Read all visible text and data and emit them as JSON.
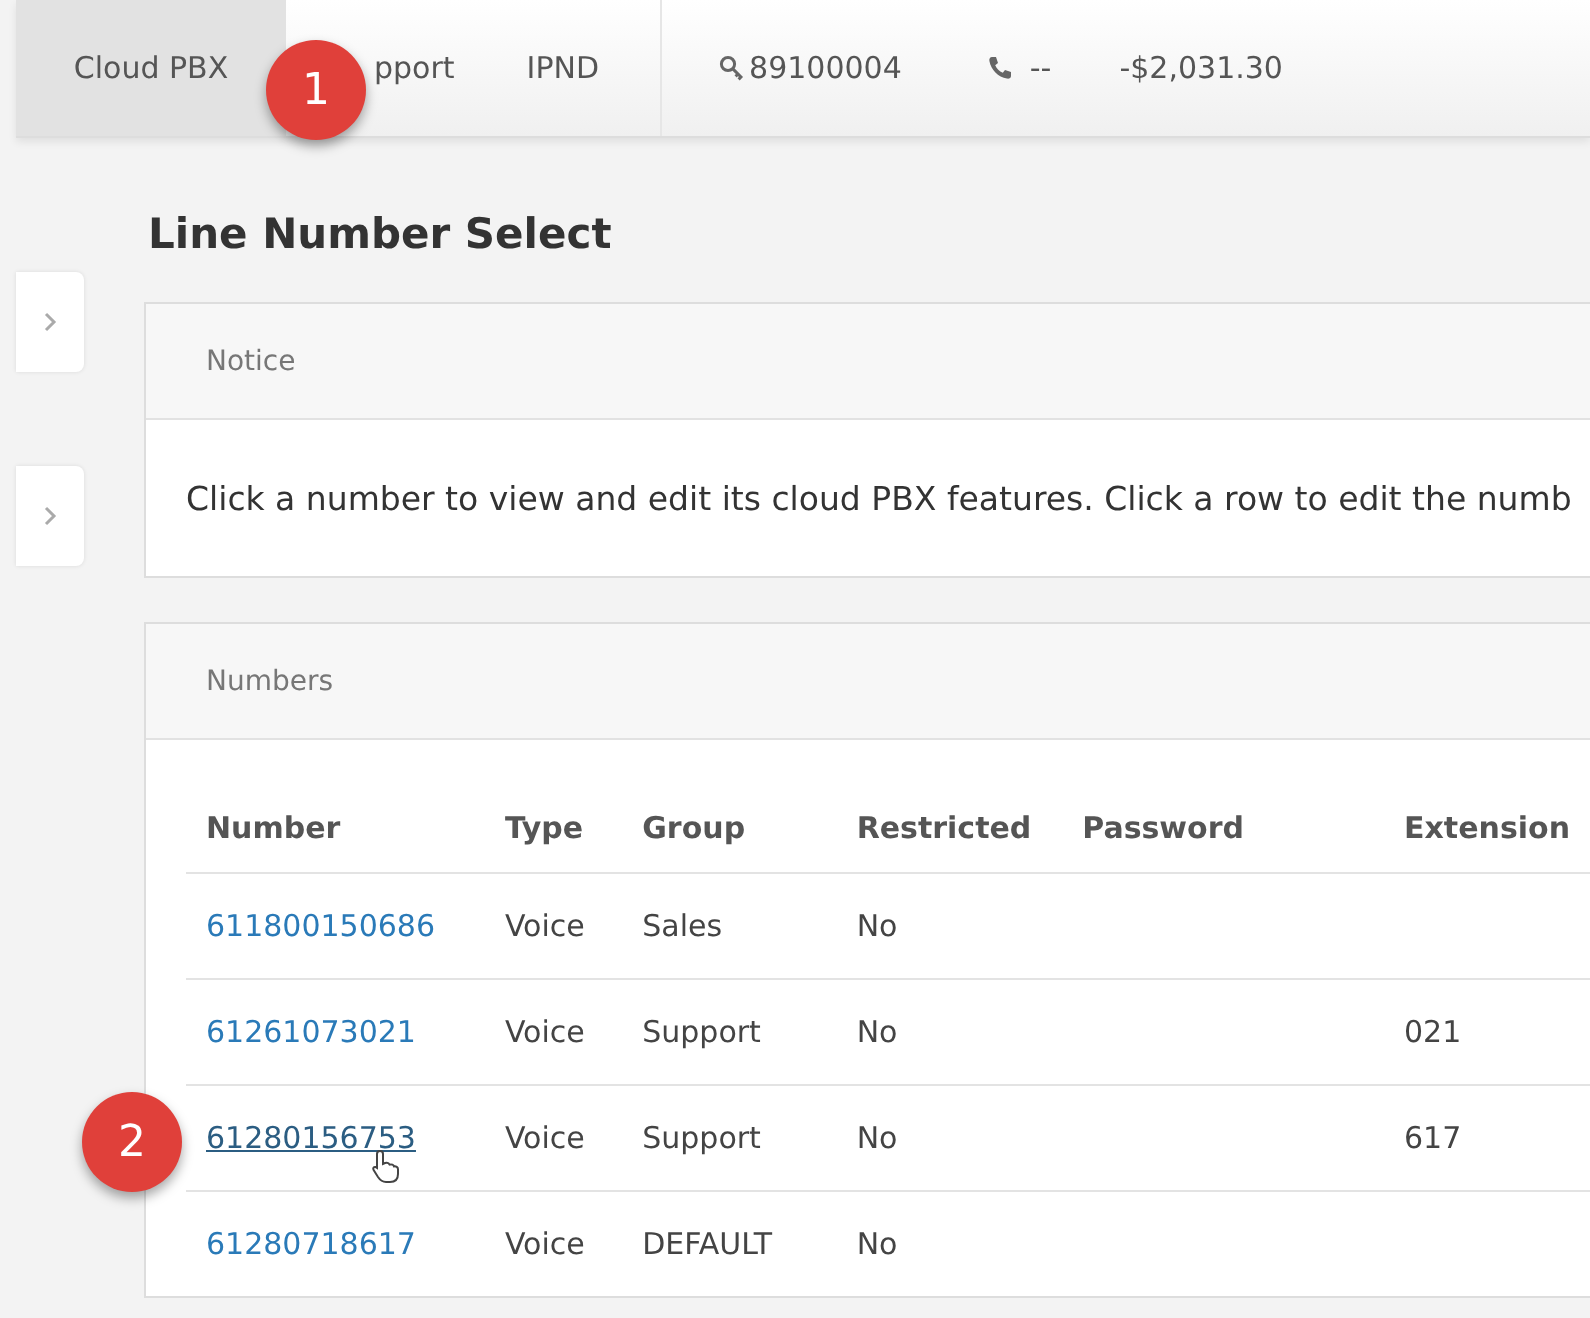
{
  "nav": {
    "items": [
      {
        "label": "Cloud PBX",
        "selected": true
      },
      {
        "label": "pport",
        "selected": false
      },
      {
        "label": "IPND",
        "selected": false
      }
    ],
    "account": "89100004",
    "phone": "--",
    "balance": "-$2,031.30"
  },
  "annotations": [
    "1",
    "2"
  ],
  "page_title": "Line Number Select",
  "notice": {
    "title": "Notice",
    "text": "Click a number to view and edit its cloud PBX features. Click a row to edit the numb"
  },
  "numbers": {
    "title": "Numbers",
    "columns": [
      "Number",
      "Type",
      "Group",
      "Restricted",
      "Password",
      "Extension"
    ],
    "rows": [
      {
        "number": "611800150686",
        "type": "Voice",
        "group": "Sales",
        "restricted": "No",
        "extension": "",
        "hovered": false
      },
      {
        "number": "61261073021",
        "type": "Voice",
        "group": "Support",
        "restricted": "No",
        "extension": "021",
        "hovered": false
      },
      {
        "number": "61280156753",
        "type": "Voice",
        "group": "Support",
        "restricted": "No",
        "extension": "617",
        "hovered": true
      },
      {
        "number": "61280718617",
        "type": "Voice",
        "group": "DEFAULT",
        "restricted": "No",
        "extension": "",
        "hovered": false
      }
    ]
  }
}
